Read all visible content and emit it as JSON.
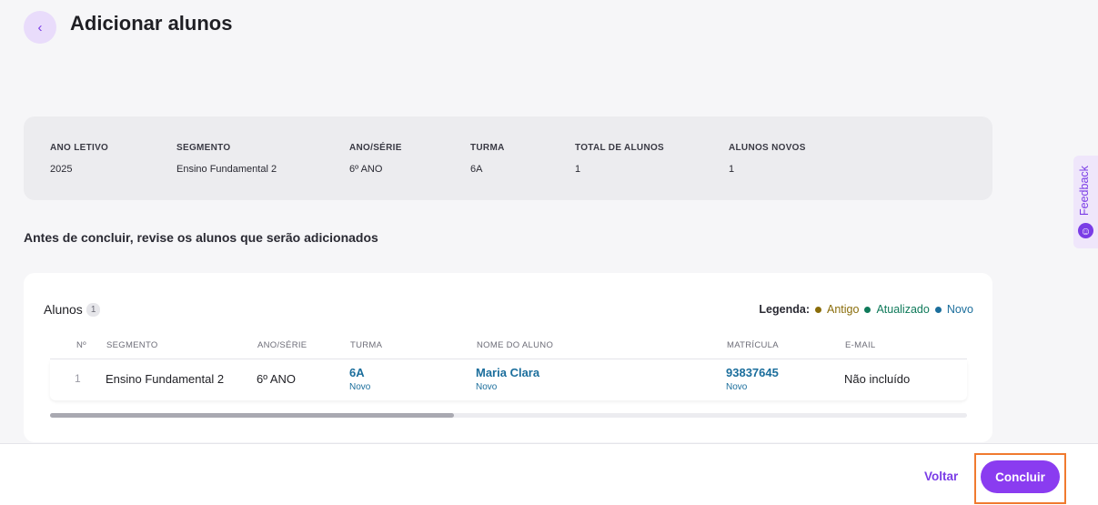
{
  "header": {
    "back_icon": "‹",
    "title": "Adicionar alunos"
  },
  "summary": {
    "fields": [
      {
        "label": "ANO LETIVO",
        "value": "2025"
      },
      {
        "label": "SEGMENTO",
        "value": "Ensino Fundamental 2"
      },
      {
        "label": "ANO/SÉRIE",
        "value": "6º ANO"
      },
      {
        "label": "TURMA",
        "value": "6A"
      },
      {
        "label": "TOTAL DE ALUNOS",
        "value": "1"
      },
      {
        "label": "ALUNOS NOVOS",
        "value": "1"
      }
    ]
  },
  "review_text": "Antes de concluir, revise os alunos que serão adicionados",
  "students_card": {
    "title": "Alunos",
    "count": "1",
    "legend": {
      "title": "Legenda:",
      "items": [
        {
          "label": "Antigo",
          "color": "#8a6d0a"
        },
        {
          "label": "Atualizado",
          "color": "#0f7a5a"
        },
        {
          "label": "Novo",
          "color": "#1b6e9c"
        }
      ]
    },
    "columns": [
      "Nº",
      "SEGMENTO",
      "ANO/SÉRIE",
      "TURMA",
      "NOME DO ALUNO",
      "MATRÍCULA",
      "E-MAIL"
    ],
    "rows": [
      {
        "number": "1",
        "segment": "Ensino Fundamental 2",
        "grade": "6º ANO",
        "class": "6A",
        "class_status": "Novo",
        "name": "Maria Clara",
        "name_status": "Novo",
        "registration": "93837645",
        "registration_status": "Novo",
        "email": "Não incluído"
      }
    ],
    "scroll_fraction": 0.44
  },
  "footer": {
    "back_label": "Voltar",
    "conclude_label": "Concluir"
  },
  "feedback": {
    "label": "Feedback",
    "icon": "☺"
  },
  "colors": {
    "accent": "#8a3cf0",
    "link": "#1b6e9c",
    "highlight": "#f07a2f"
  }
}
